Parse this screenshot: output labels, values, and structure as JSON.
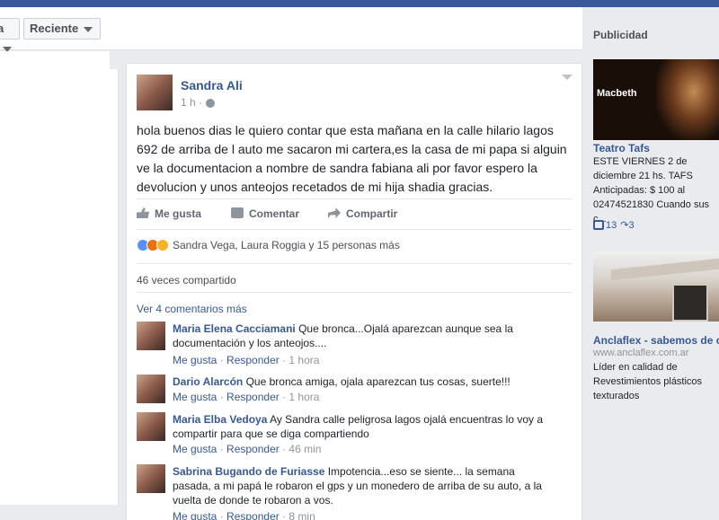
{
  "filters": {
    "first_label": "a",
    "sort_label": "Reciente"
  },
  "post": {
    "author": "Sandra Ali",
    "time": "1 h ·",
    "text": "hola buenos dias le quiero contar que esta mañana en la calle hilario lagos 692 de arriba de l auto me sacaron mi cartera,es la casa de mi papa si alguin ve la documentacion a nombre de sandra fabiana ali por favor espero la devolucion y unos anteojos recetados de mi hija shadia gracias.",
    "actions": {
      "like": "Me gusta",
      "comment": "Comentar",
      "share": "Compartir"
    },
    "reactions_text": "Sandra Vega, Laura Roggia y 15 personas más",
    "shares_text": "46 veces compartido",
    "more_comments": "Ver 4 comentarios más"
  },
  "comments": [
    {
      "name": "Maria Elena Cacciamani",
      "text": "Que bronca...Ojalá aparezcan aunque sea la documentación y los anteojos....",
      "like": "Me gusta",
      "reply": "Responder",
      "time": "1 hora"
    },
    {
      "name": "Dario Alarcón",
      "text": "Que bronca amiga, ojala aparezcan tus cosas, suerte!!!",
      "like": "Me gusta",
      "reply": "Responder",
      "time": "1 hora"
    },
    {
      "name": "Maria Elba Vedoya",
      "text": "Ay Sandra calle peligrosa lagos ojalá encuentras lo voy a compartir para que se diga compartiendo",
      "like": "Me gusta",
      "reply": "Responder",
      "time": "46 min"
    },
    {
      "name": "Sabrina Bugando de Furiasse",
      "text": "Impotencia...eso se siente... la semana pasada, a mi papá le robaron el gps y un monedero de arriba de su auto, a la vuelta de donde te robaron a vos.",
      "like": "Me gusta",
      "reply": "Responder",
      "time": "8 min"
    }
  ],
  "sidebar": {
    "heading": "Publicidad",
    "ad1": {
      "image_title": "Macbeth",
      "title": "Teatro Tafs",
      "desc": "ESTE VIERNES 2 de diciembre 21 hs. TAFS Anticipadas: $ 100 al 02474521830 Cuando sus c...",
      "likes": "13",
      "shares": "3"
    },
    "ad2": {
      "title": "Anclaflex - sabemos de c...",
      "url": "www.anclaflex.com.ar",
      "desc": "Líder en calidad de Revestimientos plásticos texturados"
    }
  },
  "colors": {
    "brand": "#3b5998",
    "link": "#365899",
    "background": "#e9ebee"
  }
}
